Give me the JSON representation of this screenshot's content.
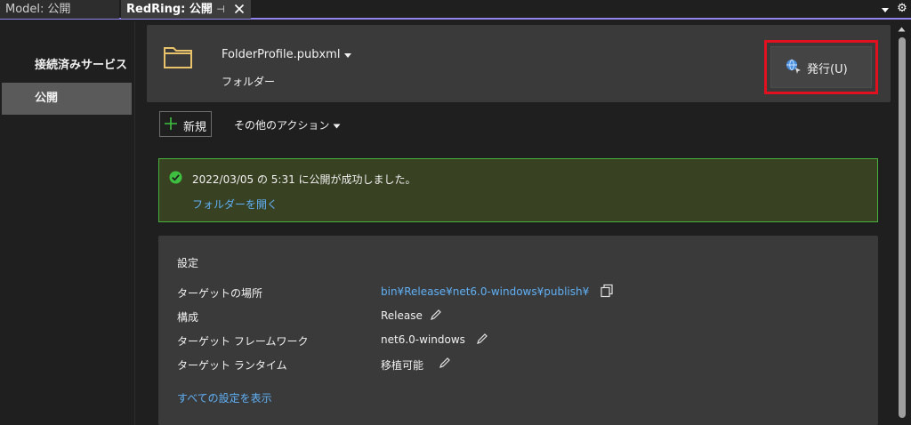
{
  "tabs": [
    {
      "label": "Model: 公開"
    },
    {
      "label": "RedRing: 公開"
    }
  ],
  "icons": {
    "pin": "pin-icon",
    "close": "close-icon",
    "tab_dropdown": "chevron-down-icon",
    "settings": "gear-icon"
  },
  "sidebar": {
    "items": [
      {
        "label": "接続済みサービス"
      },
      {
        "label": "公開"
      }
    ]
  },
  "profile": {
    "name": "FolderProfile.pubxml",
    "type": "フォルダー"
  },
  "publish_button": {
    "label": "発行(U)"
  },
  "actions": {
    "new_label": "新規",
    "other_label": "その他のアクション"
  },
  "status": {
    "message": "2022/03/05 の 5:31 に公開が成功しました。",
    "link": "フォルダーを開く"
  },
  "settings": {
    "title": "設定",
    "rows": [
      {
        "label": "ターゲットの場所",
        "value": "bin¥Release¥net6.0-windows¥publish¥"
      },
      {
        "label": "構成",
        "value": "Release"
      },
      {
        "label": "ターゲット フレームワーク",
        "value": "net6.0-windows"
      },
      {
        "label": "ターゲット ランタイム",
        "value": "移植可能"
      }
    ],
    "show_all": "すべての設定を表示"
  },
  "colors": {
    "accent": "#9184ee",
    "link": "#5fb0f6",
    "success_border": "#46b23c",
    "success_bg": "#394123",
    "highlight": "#e0101f"
  }
}
